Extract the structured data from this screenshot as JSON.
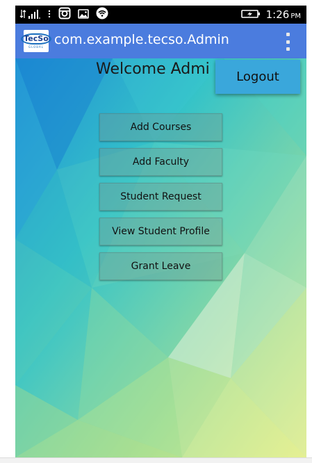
{
  "status_bar": {
    "time": "1:26",
    "ampm": "PM",
    "icons": [
      "data-arrows-icon",
      "signal-bars-icon",
      "more-notifications-icon",
      "instagram-icon",
      "image-icon",
      "wifi-icon",
      "battery-charging-icon"
    ]
  },
  "action_bar": {
    "title": "com.example.tecso.Admin",
    "logo_text": "TecSo",
    "logo_subtext": "GLOBAL",
    "overflow_icon": "more-vert-icon",
    "color": "#4b7cde"
  },
  "main": {
    "welcome_text": "Welcome Admi",
    "buttons": [
      {
        "label": "Add Courses"
      },
      {
        "label": "Add Faculty"
      },
      {
        "label": "Student Request"
      },
      {
        "label": "View Student Profile"
      },
      {
        "label": "Grant Leave"
      }
    ]
  },
  "overflow_menu": {
    "items": [
      {
        "label": "Logout"
      }
    ],
    "color": "#3aa7db"
  }
}
